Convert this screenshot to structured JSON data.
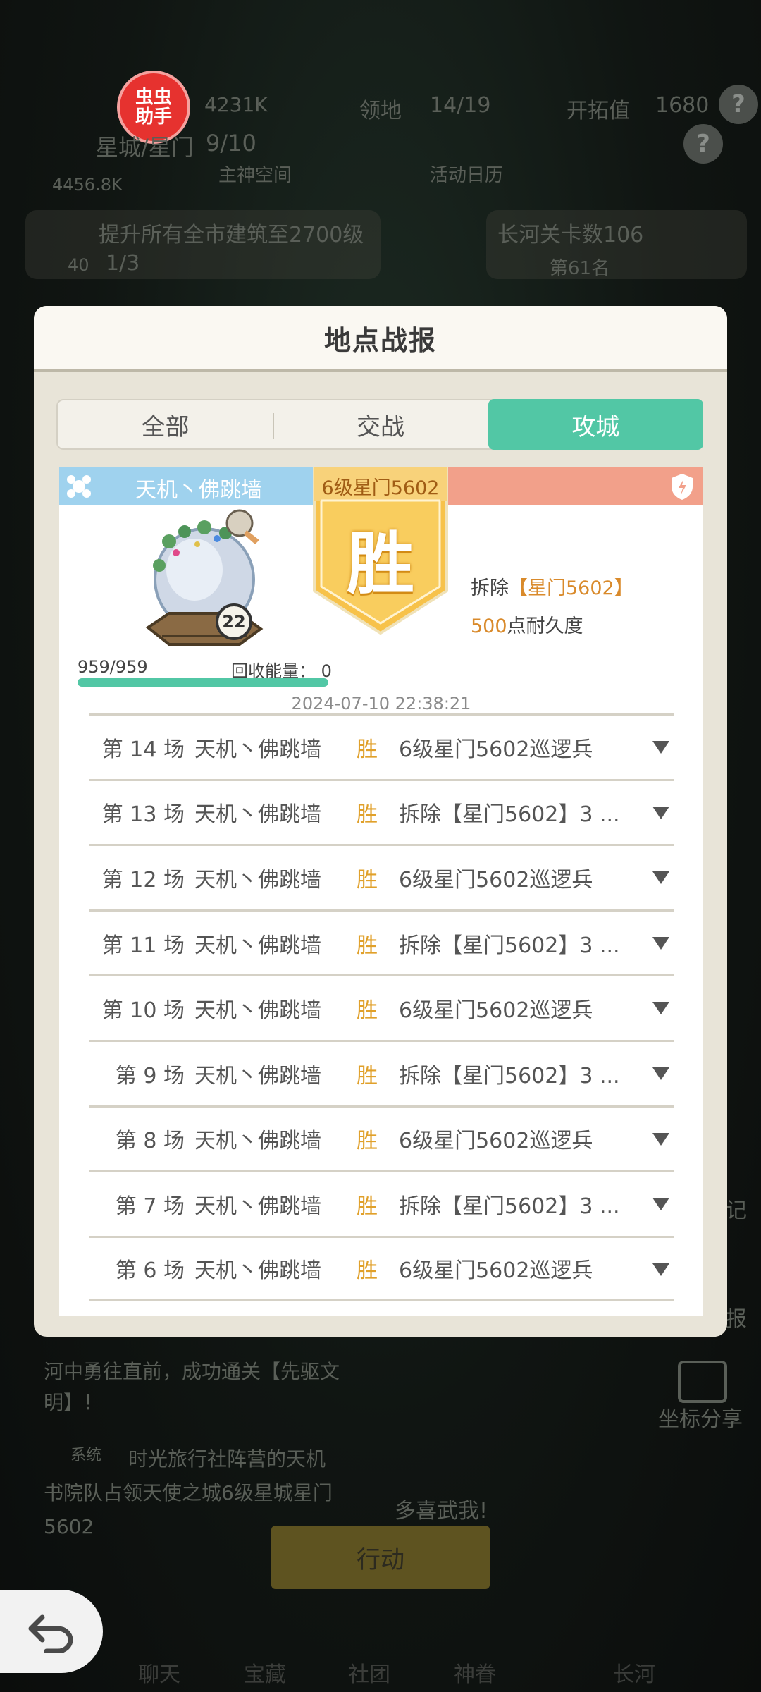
{
  "background": {
    "badge": {
      "line1": "虫虫",
      "line2": "助手"
    },
    "top_stats": [
      "4231K",
      "领地",
      "14/19",
      "开拓值",
      "1680"
    ],
    "location": "星城/星门",
    "location_count": "9/10",
    "sub_items": [
      "主神空间",
      "活动日历"
    ],
    "power": "4456.8K",
    "task_text": "提升所有全市建筑至2700级",
    "task_progress": "1/3",
    "task_badge": "40",
    "stage_text": "长河关卡数106",
    "stage_rank": "第61名",
    "story_text_1": "河中勇往直前，成功通关【先驱文明】！",
    "story_text_2": "时光旅行社阵营的天机书院队占领天使之城6级星城星门5602",
    "story_tag": "系统",
    "banner_text": "多喜武我!",
    "action_label": "行动",
    "share_label": "坐标分享",
    "side_labels": [
      "记",
      "报"
    ],
    "nav": [
      "聊天",
      "宝藏",
      "社团",
      "神眷",
      "长河"
    ]
  },
  "modal": {
    "title": "地点战报",
    "tabs": [
      {
        "label": "全部",
        "active": false
      },
      {
        "label": "交战",
        "active": false
      },
      {
        "label": "攻城",
        "active": true
      }
    ],
    "summary": {
      "player_name": "天机丶佛跳墙",
      "ribbon_label": "6级星门5602",
      "result": "胜",
      "demolish_prefix": "拆除",
      "demolish_target": "【星门5602】",
      "durability_value": "500",
      "durability_suffix": "点耐久度",
      "unit_level": "22",
      "hp_text": "959/959",
      "hp_ratio": 1.0,
      "energy_text": "回收能量：  0",
      "timestamp": "2024-07-10 22:38:21"
    },
    "battles": [
      {
        "round": "第 14 场",
        "player": "天机丶佛跳墙",
        "result": "胜",
        "desc": "6级星门5602巡逻兵"
      },
      {
        "round": "第 13 场",
        "player": "天机丶佛跳墙",
        "result": "胜",
        "desc": "拆除【星门5602】3 ..."
      },
      {
        "round": "第 12 场",
        "player": "天机丶佛跳墙",
        "result": "胜",
        "desc": "6级星门5602巡逻兵"
      },
      {
        "round": "第 11 场",
        "player": "天机丶佛跳墙",
        "result": "胜",
        "desc": "拆除【星门5602】3 ..."
      },
      {
        "round": "第 10 场",
        "player": "天机丶佛跳墙",
        "result": "胜",
        "desc": "6级星门5602巡逻兵"
      },
      {
        "round": "第 9 场",
        "player": "天机丶佛跳墙",
        "result": "胜",
        "desc": "拆除【星门5602】3 ..."
      },
      {
        "round": "第 8 场",
        "player": "天机丶佛跳墙",
        "result": "胜",
        "desc": "6级星门5602巡逻兵"
      },
      {
        "round": "第 7 场",
        "player": "天机丶佛跳墙",
        "result": "胜",
        "desc": "拆除【星门5602】3 ..."
      },
      {
        "round": "第 6 场",
        "player": "天机丶佛跳墙",
        "result": "胜",
        "desc": "6级星门5602巡逻兵"
      }
    ]
  },
  "colors": {
    "accent_teal": "#52c7a5",
    "win_orange": "#e0a02a",
    "header_blue": "#9fd2ee",
    "header_red": "#f2a08a"
  }
}
